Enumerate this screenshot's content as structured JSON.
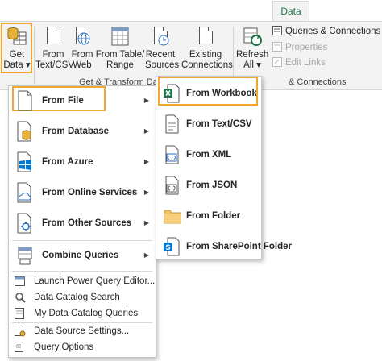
{
  "ribbon": {
    "tab_data": "Data",
    "buttons": {
      "get_data": [
        "Get",
        "Data ▾"
      ],
      "from_text_csv": [
        "From",
        "Text/CSV"
      ],
      "from_web": [
        "From",
        "Web"
      ],
      "from_table_range": [
        "From Table/",
        "Range"
      ],
      "recent_sources": [
        "Recent",
        "Sources"
      ],
      "existing_connections": [
        "Existing",
        "Connections"
      ],
      "refresh_all": [
        "Refresh",
        "All ▾"
      ]
    },
    "group_get_transform": "Get & Transform Data",
    "group_connections": "& Connections",
    "queries_connections": "Queries & Connections",
    "properties": "Properties",
    "edit_links": "Edit Links"
  },
  "menu": {
    "items": [
      {
        "label": "From File",
        "icon": "file-icon",
        "submenu": true
      },
      {
        "label": "From Database",
        "icon": "database-icon",
        "submenu": true
      },
      {
        "label": "From Azure",
        "icon": "azure-icon",
        "submenu": true
      },
      {
        "label": "From Online Services",
        "icon": "cloud-icon",
        "submenu": true
      },
      {
        "label": "From Other Sources",
        "icon": "other-sources-icon",
        "submenu": true
      },
      {
        "label": "Combine Queries",
        "icon": "combine-queries-icon",
        "submenu": true
      }
    ],
    "small_items": [
      {
        "label": "Launch Power Query Editor...",
        "icon": "power-query-editor-icon"
      },
      {
        "label": "Data Catalog Search",
        "icon": "catalog-search-icon"
      },
      {
        "label": "My Data Catalog Queries",
        "icon": "catalog-queries-icon"
      },
      {
        "label": "Data Source Settings...",
        "icon": "data-source-settings-icon"
      },
      {
        "label": "Query Options",
        "icon": "query-options-icon"
      }
    ]
  },
  "submenu": {
    "items": [
      {
        "label": "From Workbook",
        "icon": "excel-workbook-icon"
      },
      {
        "label": "From Text/CSV",
        "icon": "text-csv-icon"
      },
      {
        "label": "From XML",
        "icon": "xml-icon"
      },
      {
        "label": "From JSON",
        "icon": "json-icon"
      },
      {
        "label": "From Folder",
        "icon": "folder-icon"
      },
      {
        "label": "From SharePoint Folder",
        "icon": "sharepoint-folder-icon"
      }
    ]
  },
  "colors": {
    "highlight": "#f0a830",
    "excel_green": "#217346",
    "azure_blue": "#0078d4",
    "db_gold": "#e8b23a",
    "folder": "#f2c267"
  }
}
